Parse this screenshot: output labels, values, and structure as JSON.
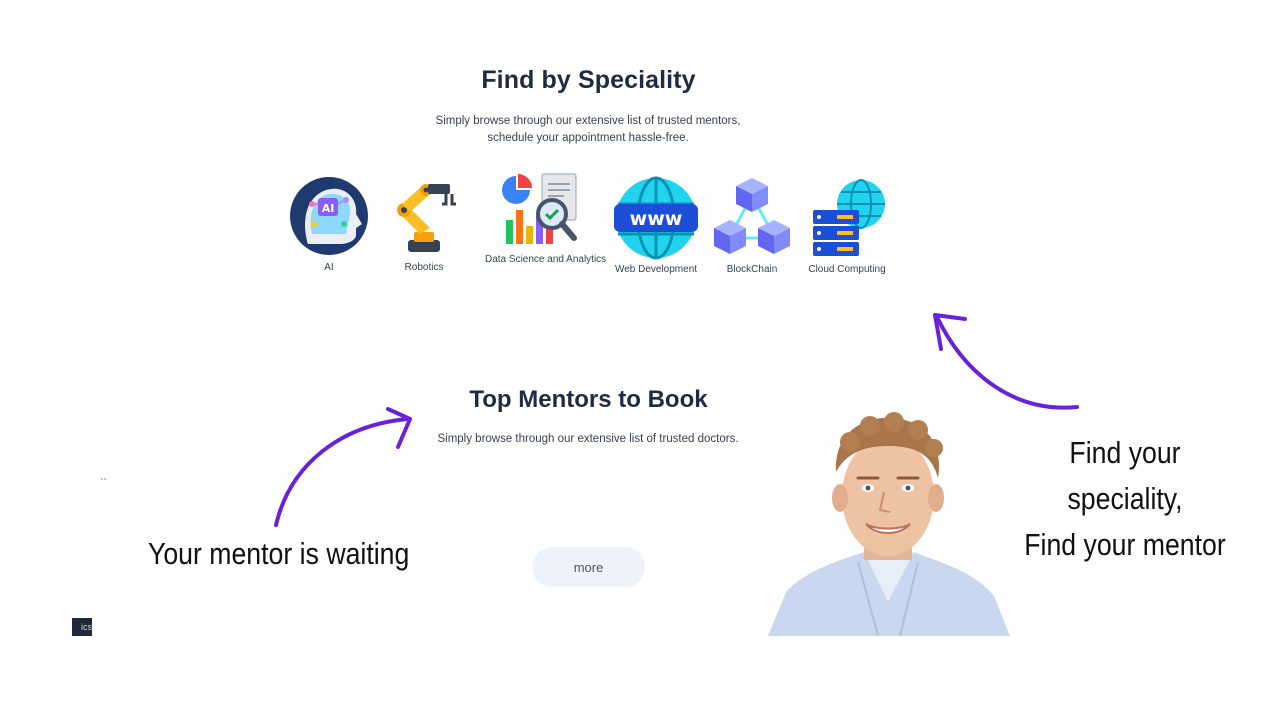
{
  "speciality": {
    "title": "Find by Speciality",
    "subtitle_line1": "Simply browse through our extensive list of trusted mentors,",
    "subtitle_line2": "schedule your appointment hassle-free.",
    "items": [
      {
        "label": "AI",
        "icon": "ai-head-icon"
      },
      {
        "label": "Robotics",
        "icon": "robot-arm-icon"
      },
      {
        "label": "Data Science and Analytics",
        "icon": "data-analytics-icon"
      },
      {
        "label": "Web Development",
        "icon": "www-globe-icon"
      },
      {
        "label": "BlockChain",
        "icon": "blockchain-cubes-icon"
      },
      {
        "label": "Cloud Computing",
        "icon": "cloud-server-icon"
      }
    ]
  },
  "mentors": {
    "title": "Top Mentors to Book",
    "subtitle": "Simply browse through our extensive list of trusted doctors.",
    "more_label": "more"
  },
  "annotations": {
    "left_caption": "Your mentor is waiting",
    "right_caption_line1": "Find your speciality,",
    "right_caption_line2": "Find your mentor",
    "arrow_color": "#6a22d9",
    "tick": "``",
    "tab_fragment": "ics"
  },
  "colors": {
    "heading": "#1f2a44",
    "button_bg": "#eef2fb"
  }
}
